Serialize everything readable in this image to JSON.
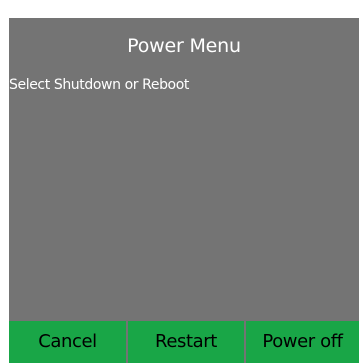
{
  "dialog": {
    "title": "Power Menu",
    "message": "Select Shutdown or Reboot"
  },
  "buttons": {
    "cancel_label": "Cancel",
    "restart_label": "Restart",
    "power_off_label": "Power off"
  },
  "colors": {
    "dialog_background": "#747474",
    "button_background": "#19a647",
    "title_text": "#ffffff",
    "button_text": "#000000"
  }
}
